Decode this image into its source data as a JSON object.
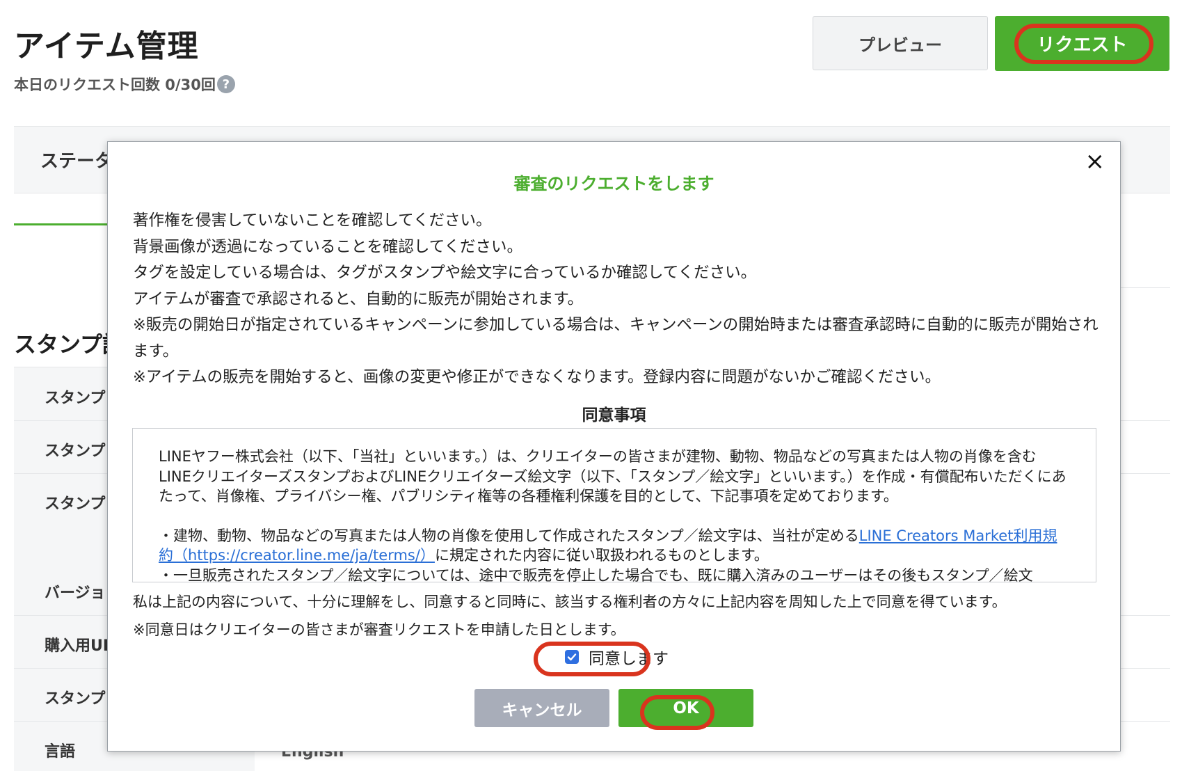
{
  "page": {
    "title": "アイテム管理",
    "request_count": "本日のリクエスト回数 0/30回",
    "help_icon": "?",
    "preview_button": "プレビュー",
    "request_button": "リクエスト",
    "status_label": "ステータ",
    "section_title": "スタンプ詳",
    "side_rows": [
      "スタンプ",
      "スタンプ",
      "スタンプ",
      "バージョ",
      "購入用UF",
      "スタンプ",
      "言語"
    ],
    "language_value": "English"
  },
  "modal": {
    "title": "審査のリクエストをします",
    "close_icon": "×",
    "body": [
      "著作権を侵害していないことを確認してください。",
      "背景画像が透過になっていることを確認してください。",
      "タグを設定している場合は、タグがスタンプや絵文字に合っているか確認してください。",
      "アイテムが審査で承認されると、自動的に販売が開始されます。",
      "※販売の開始日が指定されているキャンペーンに参加している場合は、キャンペーンの開始時または審査承認時に自動的に販売が開始されます。",
      "※アイテムの販売を開始すると、画像の変更や修正ができなくなります。登録内容に問題がないかご確認ください。"
    ],
    "agreement_title": "同意事項",
    "terms": {
      "paragraph1": "LINEヤフー株式会社（以下、「当社」といいます。）は、クリエイターの皆さまが建物、動物、物品などの写真または人物の肖像を含むLINEクリエイターズスタンプおよびLINEクリエイターズ絵文字（以下、「スタンプ／絵文字」といいます。）を作成・有償配布いただくにあたって、肖像権、プライバシー権、パブリシティ権等の各種権利保護を目的として、下記事項を定めております。",
      "paragraph2_before_link": "・建物、動物、物品などの写真または人物の肖像を使用して作成されたスタンプ／絵文字は、当社が定める",
      "paragraph2_link": "LINE Creators Market利用規約（https://creator.line.me/ja/terms/）",
      "paragraph2_after_link": "に規定された内容に従い取扱われるものとします。",
      "paragraph3": "・一旦販売されたスタンプ／絵文字については、途中で販売を停止した場合でも、既に購入済みのユーザーはその後もスタンプ／絵文"
    },
    "consent_text_1": "私は上記の内容について、十分に理解をし、同意すると同時に、該当する権利者の方々に上記内容を周知した上で同意を得ています。",
    "consent_text_2": "※同意日はクリエイターの皆さまが審査リクエストを申請した日とします。",
    "agree_checkbox_label": "同意します",
    "agree_checked": true,
    "cancel_button": "キャンセル",
    "ok_button": "OK"
  },
  "colors": {
    "accent_green": "#4cae2f",
    "highlight_red": "#d9341e",
    "link_blue": "#2a6fd6",
    "cancel_gray": "#a8adb9"
  }
}
